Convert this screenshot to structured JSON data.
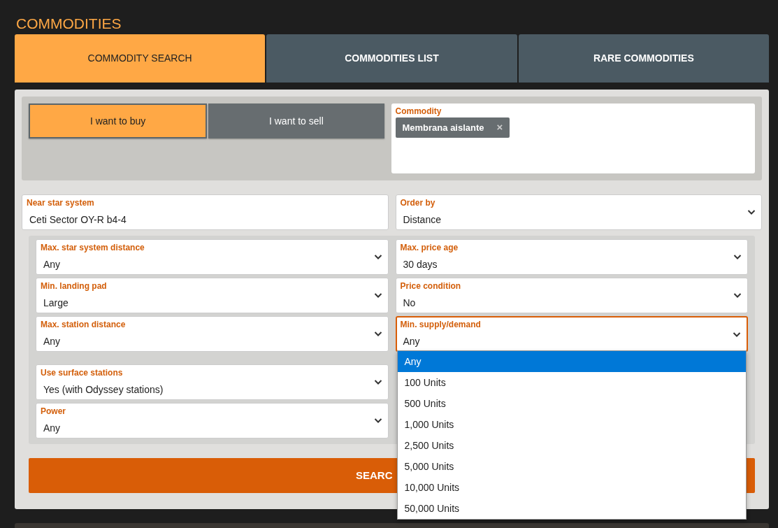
{
  "page_title": "COMMODITIES",
  "tabs": [
    {
      "label": "COMMODITY SEARCH",
      "selected": true
    },
    {
      "label": "COMMODITIES LIST",
      "selected": false
    },
    {
      "label": "RARE COMMODITIES",
      "selected": false
    }
  ],
  "mode_buttons": [
    {
      "label": "I want to buy",
      "selected": true
    },
    {
      "label": "I want to sell",
      "selected": false
    }
  ],
  "commodity": {
    "label": "Commodity",
    "tags": [
      {
        "text": "Membrana aislante",
        "remove": "×"
      }
    ]
  },
  "near_star_system": {
    "label": "Near star system",
    "value": "Ceti Sector OY-R b4-4"
  },
  "order_by": {
    "label": "Order by",
    "value": "Distance"
  },
  "filters_left": [
    [
      {
        "label": "Max. star system distance",
        "value": "Any"
      },
      {
        "label": "Min. landing pad",
        "value": "Large"
      },
      {
        "label": "Max. station distance",
        "value": "Any"
      }
    ],
    [
      {
        "label": "Use surface stations",
        "value": "Yes (with Odyssey stations)"
      },
      {
        "label": "Power",
        "value": "Any"
      }
    ]
  ],
  "filters_right": [
    {
      "label": "Max. price age",
      "value": "30 days",
      "focused": false
    },
    {
      "label": "Price condition",
      "value": "No",
      "focused": false
    },
    {
      "label": "Min. supply/demand",
      "value": "Any",
      "focused": true,
      "options": [
        {
          "text": "Any",
          "selected": true
        },
        {
          "text": "100 Units",
          "selected": false
        },
        {
          "text": "500 Units",
          "selected": false
        },
        {
          "text": "1,000 Units",
          "selected": false
        },
        {
          "text": "2,500 Units",
          "selected": false
        },
        {
          "text": "5,000 Units",
          "selected": false
        },
        {
          "text": "10,000 Units",
          "selected": false
        },
        {
          "text": "50,000 Units",
          "selected": false
        }
      ]
    }
  ],
  "search_button": "SEARC"
}
